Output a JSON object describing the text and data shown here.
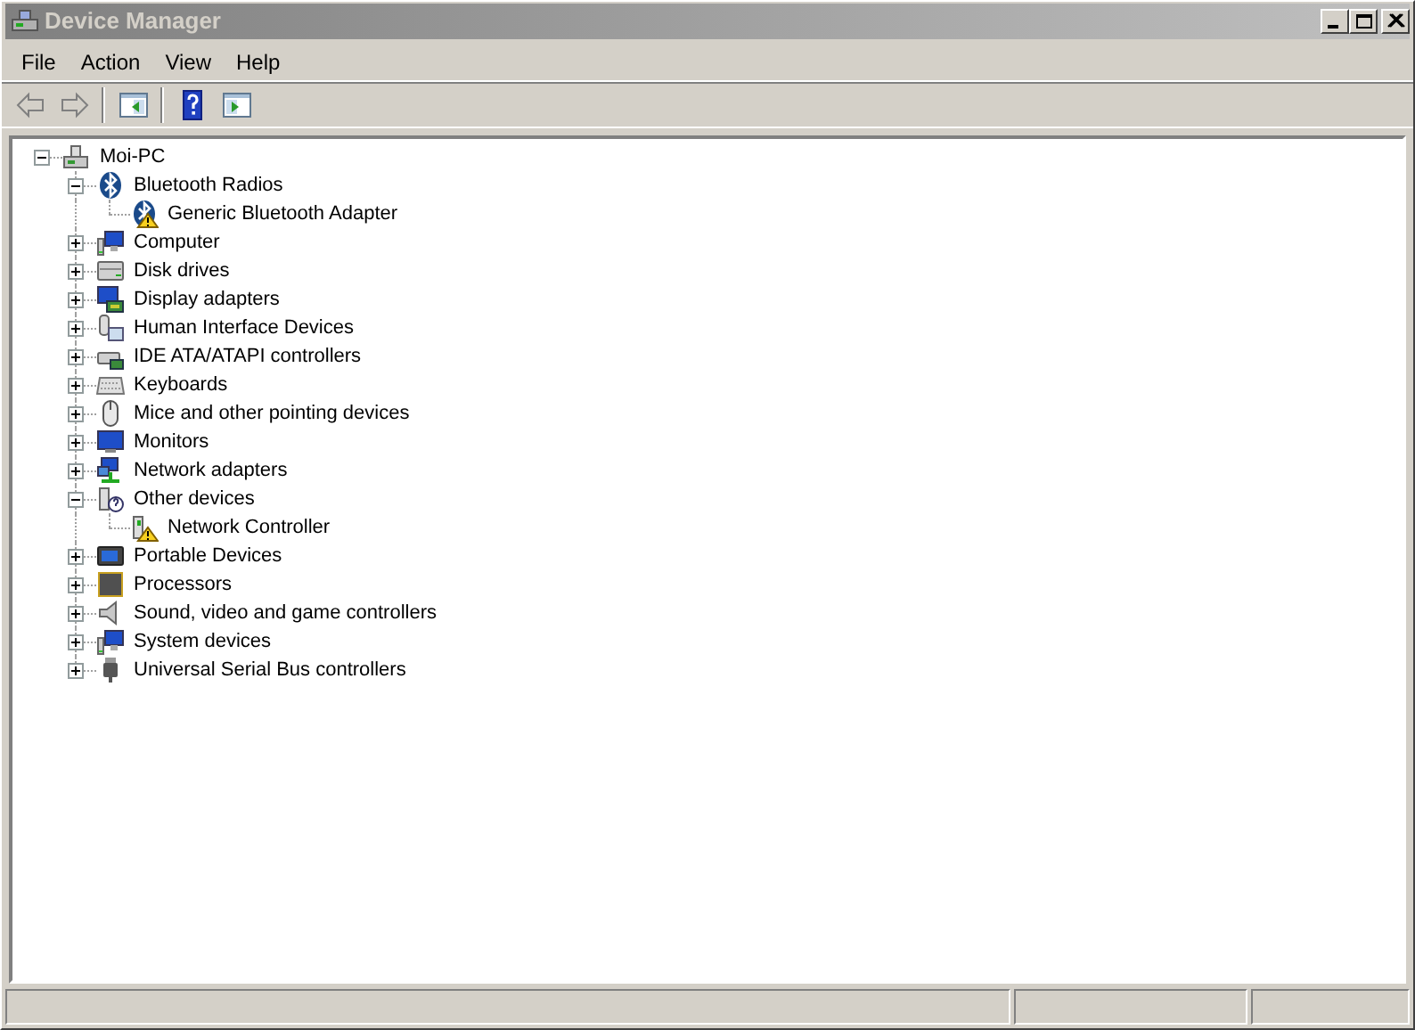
{
  "window": {
    "title": "Device Manager",
    "active": false
  },
  "menu": [
    "File",
    "Action",
    "View",
    "Help"
  ],
  "toolbar": [
    {
      "kind": "back",
      "disabled": true
    },
    {
      "kind": "forward",
      "disabled": true
    },
    {
      "kind": "separator"
    },
    {
      "kind": "tree-pane"
    },
    {
      "kind": "separator"
    },
    {
      "kind": "help"
    },
    {
      "kind": "action-pane"
    }
  ],
  "tree": [
    {
      "label": "Moi-PC",
      "kind": "computer-root",
      "expanded": true,
      "children": [
        {
          "label": "Bluetooth Radios",
          "kind": "bluetooth",
          "expanded": true,
          "children": [
            {
              "label": "Generic Bluetooth Adapter",
              "kind": "bluetooth",
              "warning": true
            }
          ]
        },
        {
          "label": "Computer",
          "kind": "computer",
          "expanded": false
        },
        {
          "label": "Disk drives",
          "kind": "disk",
          "expanded": false
        },
        {
          "label": "Display adapters",
          "kind": "display",
          "expanded": false
        },
        {
          "label": "Human Interface Devices",
          "kind": "hid",
          "expanded": false
        },
        {
          "label": "IDE ATA/ATAPI controllers",
          "kind": "ide",
          "expanded": false
        },
        {
          "label": "Keyboards",
          "kind": "keyboard",
          "expanded": false
        },
        {
          "label": "Mice and other pointing devices",
          "kind": "mouse",
          "expanded": false
        },
        {
          "label": "Monitors",
          "kind": "monitor",
          "expanded": false
        },
        {
          "label": "Network adapters",
          "kind": "network",
          "expanded": false
        },
        {
          "label": "Other devices",
          "kind": "other",
          "expanded": true,
          "children": [
            {
              "label": "Network Controller",
              "kind": "unknown",
              "warning": true
            }
          ]
        },
        {
          "label": "Portable Devices",
          "kind": "portable",
          "expanded": false
        },
        {
          "label": "Processors",
          "kind": "processor",
          "expanded": false
        },
        {
          "label": "Sound, video and game controllers",
          "kind": "sound",
          "expanded": false
        },
        {
          "label": "System devices",
          "kind": "computer",
          "expanded": false
        },
        {
          "label": "Universal Serial Bus controllers",
          "kind": "usb",
          "expanded": false
        }
      ]
    }
  ]
}
